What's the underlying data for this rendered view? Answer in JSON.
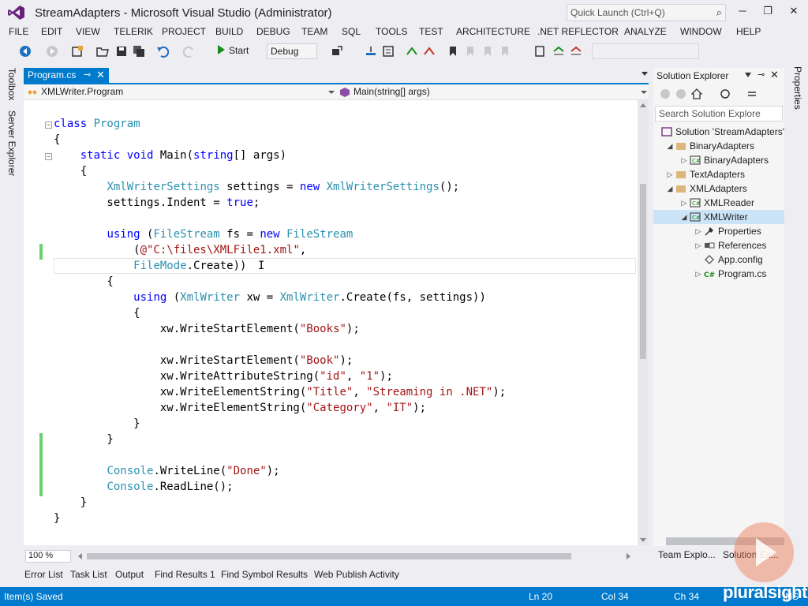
{
  "window": {
    "title": "StreamAdapters - Microsoft Visual Studio (Administrator)",
    "quick_launch_placeholder": "Quick Launch (Ctrl+Q)",
    "minimize": "─",
    "restore": "❐",
    "close": "✕"
  },
  "menu": [
    "FILE",
    "EDIT",
    "VIEW",
    "TELERIK",
    "PROJECT",
    "BUILD",
    "DEBUG",
    "TEAM",
    "SQL",
    "TOOLS",
    "TEST",
    "ARCHITECTURE",
    ".NET REFLECTOR",
    "ANALYZE",
    "WINDOW",
    "HELP"
  ],
  "toolbar": {
    "start_label": "Start",
    "configuration": "Debug"
  },
  "left_tabs": [
    "Toolbox",
    "Server Explorer"
  ],
  "right_tabs": [
    "Properties"
  ],
  "document": {
    "tab_label": "Program.cs",
    "pin": "⊸",
    "close": "✕",
    "nav_type": "XMLWriter.Program",
    "nav_member": "Main(string[] args)"
  },
  "editor": {
    "zoom": "100 %",
    "lines": [
      {
        "tokens": [
          {
            "t": "class ",
            "c": "kw"
          },
          {
            "t": "Program",
            "c": "ty"
          }
        ]
      },
      {
        "tokens": [
          {
            "t": "{",
            "c": ""
          }
        ]
      },
      {
        "tokens": [
          {
            "t": "    ",
            "c": ""
          },
          {
            "t": "static",
            "c": "kw"
          },
          {
            "t": " ",
            "c": ""
          },
          {
            "t": "void",
            "c": "kw"
          },
          {
            "t": " Main(",
            "c": ""
          },
          {
            "t": "string",
            "c": "kw"
          },
          {
            "t": "[] args)",
            "c": ""
          }
        ]
      },
      {
        "tokens": [
          {
            "t": "    {",
            "c": ""
          }
        ]
      },
      {
        "tokens": [
          {
            "t": "        ",
            "c": ""
          },
          {
            "t": "XmlWriterSettings",
            "c": "ty"
          },
          {
            "t": " settings = ",
            "c": ""
          },
          {
            "t": "new",
            "c": "kw"
          },
          {
            "t": " ",
            "c": ""
          },
          {
            "t": "XmlWriterSettings",
            "c": "ty"
          },
          {
            "t": "();",
            "c": ""
          }
        ]
      },
      {
        "tokens": [
          {
            "t": "        settings.Indent = ",
            "c": ""
          },
          {
            "t": "true",
            "c": "kw"
          },
          {
            "t": ";",
            "c": ""
          }
        ]
      },
      {
        "tokens": [
          {
            "t": "",
            "c": ""
          }
        ]
      },
      {
        "tokens": [
          {
            "t": "        ",
            "c": ""
          },
          {
            "t": "using",
            "c": "kw"
          },
          {
            "t": " (",
            "c": ""
          },
          {
            "t": "FileStream",
            "c": "ty"
          },
          {
            "t": " fs = ",
            "c": ""
          },
          {
            "t": "new",
            "c": "kw"
          },
          {
            "t": " ",
            "c": ""
          },
          {
            "t": "FileStream",
            "c": "ty"
          }
        ]
      },
      {
        "tokens": [
          {
            "t": "            (",
            "c": ""
          },
          {
            "t": "@\"C:\\files\\XMLFile1.xml\"",
            "c": "st"
          },
          {
            "t": ",",
            "c": ""
          }
        ]
      },
      {
        "tokens": [
          {
            "t": "            ",
            "c": ""
          },
          {
            "t": "FileMode",
            "c": "ty"
          },
          {
            "t": ".Create))",
            "c": ""
          }
        ]
      },
      {
        "tokens": [
          {
            "t": "        {",
            "c": ""
          }
        ]
      },
      {
        "tokens": [
          {
            "t": "            ",
            "c": ""
          },
          {
            "t": "using",
            "c": "kw"
          },
          {
            "t": " (",
            "c": ""
          },
          {
            "t": "XmlWriter",
            "c": "ty"
          },
          {
            "t": " xw = ",
            "c": ""
          },
          {
            "t": "XmlWriter",
            "c": "ty"
          },
          {
            "t": ".Create(fs, settings))",
            "c": ""
          }
        ]
      },
      {
        "tokens": [
          {
            "t": "            {",
            "c": ""
          }
        ]
      },
      {
        "tokens": [
          {
            "t": "                xw.WriteStartElement(",
            "c": ""
          },
          {
            "t": "\"Books\"",
            "c": "st"
          },
          {
            "t": ");",
            "c": ""
          }
        ]
      },
      {
        "tokens": [
          {
            "t": "",
            "c": ""
          }
        ]
      },
      {
        "tokens": [
          {
            "t": "                xw.WriteStartElement(",
            "c": ""
          },
          {
            "t": "\"Book\"",
            "c": "st"
          },
          {
            "t": ");",
            "c": ""
          }
        ]
      },
      {
        "tokens": [
          {
            "t": "                xw.WriteAttributeString(",
            "c": ""
          },
          {
            "t": "\"id\"",
            "c": "st"
          },
          {
            "t": ", ",
            "c": ""
          },
          {
            "t": "\"1\"",
            "c": "st"
          },
          {
            "t": ");",
            "c": ""
          }
        ]
      },
      {
        "tokens": [
          {
            "t": "                xw.WriteElementString(",
            "c": ""
          },
          {
            "t": "\"Title\"",
            "c": "st"
          },
          {
            "t": ", ",
            "c": ""
          },
          {
            "t": "\"Streaming in .NET\"",
            "c": "st"
          },
          {
            "t": ");",
            "c": ""
          }
        ]
      },
      {
        "tokens": [
          {
            "t": "                xw.WriteElementString(",
            "c": ""
          },
          {
            "t": "\"Category\"",
            "c": "st"
          },
          {
            "t": ", ",
            "c": ""
          },
          {
            "t": "\"IT\"",
            "c": "st"
          },
          {
            "t": ");",
            "c": ""
          }
        ]
      },
      {
        "tokens": [
          {
            "t": "            }",
            "c": ""
          }
        ]
      },
      {
        "tokens": [
          {
            "t": "        }",
            "c": ""
          }
        ]
      },
      {
        "tokens": [
          {
            "t": "",
            "c": ""
          }
        ]
      },
      {
        "tokens": [
          {
            "t": "        ",
            "c": ""
          },
          {
            "t": "Console",
            "c": "ty"
          },
          {
            "t": ".WriteLine(",
            "c": ""
          },
          {
            "t": "\"Done\"",
            "c": "st"
          },
          {
            "t": ");",
            "c": ""
          }
        ]
      },
      {
        "tokens": [
          {
            "t": "        ",
            "c": ""
          },
          {
            "t": "Console",
            "c": "ty"
          },
          {
            "t": ".ReadLine();",
            "c": ""
          }
        ]
      },
      {
        "tokens": [
          {
            "t": "    }",
            "c": ""
          }
        ]
      },
      {
        "tokens": [
          {
            "t": "}",
            "c": ""
          }
        ]
      }
    ]
  },
  "solution_explorer": {
    "title": "Solution Explorer",
    "search_placeholder": "Search Solution Explore",
    "tree": [
      {
        "label": "Solution 'StreamAdapters'",
        "level": 0,
        "arrow": "",
        "icon": "solution-icon"
      },
      {
        "label": "BinaryAdapters",
        "level": 1,
        "arrow": "◢",
        "icon": "project-icon"
      },
      {
        "label": "BinaryAdapters",
        "level": 2,
        "arrow": "▷",
        "icon": "csharp-project-icon"
      },
      {
        "label": "TextAdapters",
        "level": 1,
        "arrow": "▷",
        "icon": "project-icon"
      },
      {
        "label": "XMLAdapters",
        "level": 1,
        "arrow": "◢",
        "icon": "project-icon"
      },
      {
        "label": "XMLReader",
        "level": 2,
        "arrow": "▷",
        "icon": "csharp-project-icon"
      },
      {
        "label": "XMLWriter",
        "level": 2,
        "arrow": "◢",
        "icon": "csharp-project-icon",
        "selected": true
      },
      {
        "label": "Properties",
        "level": 3,
        "arrow": "▷",
        "icon": "wrench-icon"
      },
      {
        "label": "References",
        "level": 3,
        "arrow": "▷",
        "icon": "references-icon"
      },
      {
        "label": "App.config",
        "level": 3,
        "arrow": "",
        "icon": "config-file-icon"
      },
      {
        "label": "Program.cs",
        "level": 3,
        "arrow": "▷",
        "icon": "csharp-file-icon"
      }
    ],
    "bottom_tabs": [
      "Team Explo...",
      "Solution Ex..."
    ]
  },
  "bottom_tabs": [
    "Error List",
    "Task List",
    "Output",
    "Find Results 1",
    "Find Symbol Results",
    "Web Publish Activity"
  ],
  "status": {
    "message": "Item(s) Saved",
    "line": "Ln 20",
    "col": "Col 34",
    "ch": "Ch 34",
    "mode": "INS",
    "brand": "pluralsight"
  },
  "colors": {
    "accent": "#007acc",
    "keyword": "#0000ff",
    "type": "#2b91af",
    "string": "#a31515",
    "changed": "#6cd06c"
  }
}
